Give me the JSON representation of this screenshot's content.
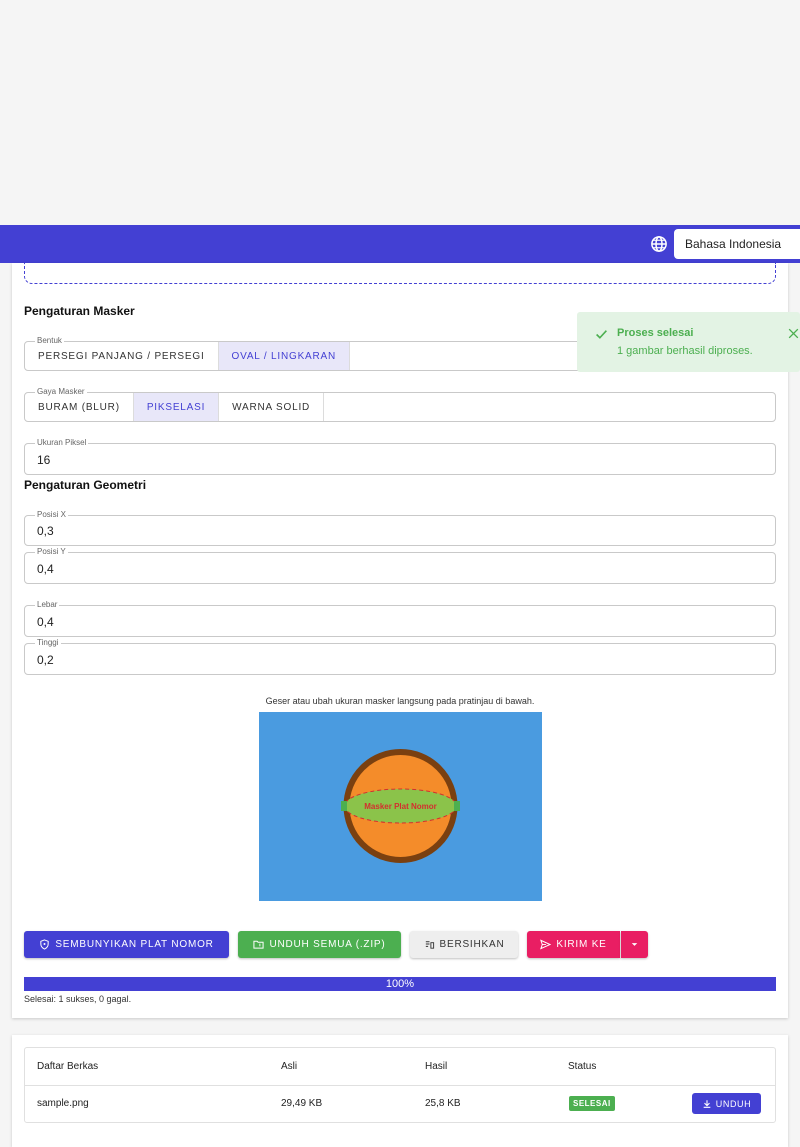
{
  "header": {
    "language_selected": "Bahasa Indonesia",
    "brand_color": "#4340d3"
  },
  "mask_settings": {
    "title": "Pengaturan Masker",
    "shape": {
      "legend": "Bentuk",
      "options": [
        "PERSEGI PANJANG / PERSEGI",
        "OVAL / LINGKARAN"
      ],
      "selected": "OVAL / LINGKARAN"
    },
    "style": {
      "legend": "Gaya Masker",
      "options": [
        "BURAM (BLUR)",
        "PIKSELASI",
        "WARNA SOLID"
      ],
      "selected": "PIKSELASI"
    },
    "pixel_size": {
      "legend": "Ukuran Piksel",
      "value": "16"
    }
  },
  "geometry": {
    "title": "Pengaturan Geometri",
    "pos_x": {
      "legend": "Posisi X",
      "value": "0,3"
    },
    "pos_y": {
      "legend": "Posisi Y",
      "value": "0,4"
    },
    "width": {
      "legend": "Lebar",
      "value": "0,4"
    },
    "height": {
      "legend": "Tinggi",
      "value": "0,2"
    }
  },
  "preview": {
    "hint": "Geser atau ubah ukuran masker langsung pada pratinjau di bawah.",
    "mask_label": "Masker Plat Nomor"
  },
  "actions": {
    "hide_plates": "SEMBUNYIKAN PLAT NOMOR",
    "download_zip": "UNDUH SEMUA (.ZIP)",
    "clear": "BERSIHKAN",
    "send_to": "KIRIM KE"
  },
  "progress": {
    "percent": 100,
    "label": "100%",
    "status": "Selesai: 1 sukses, 0 gagal."
  },
  "files": {
    "headers": [
      "Daftar Berkas",
      "Asli",
      "Hasil",
      "Status"
    ],
    "rows": [
      {
        "name": "sample.png",
        "original": "29,49 KB",
        "result": "25,8 KB",
        "status": "SELESAI",
        "action": "UNDUH"
      }
    ]
  },
  "toast": {
    "title": "Proses selesai",
    "message": "1 gambar berhasil diproses.",
    "color": "#4caf50"
  }
}
